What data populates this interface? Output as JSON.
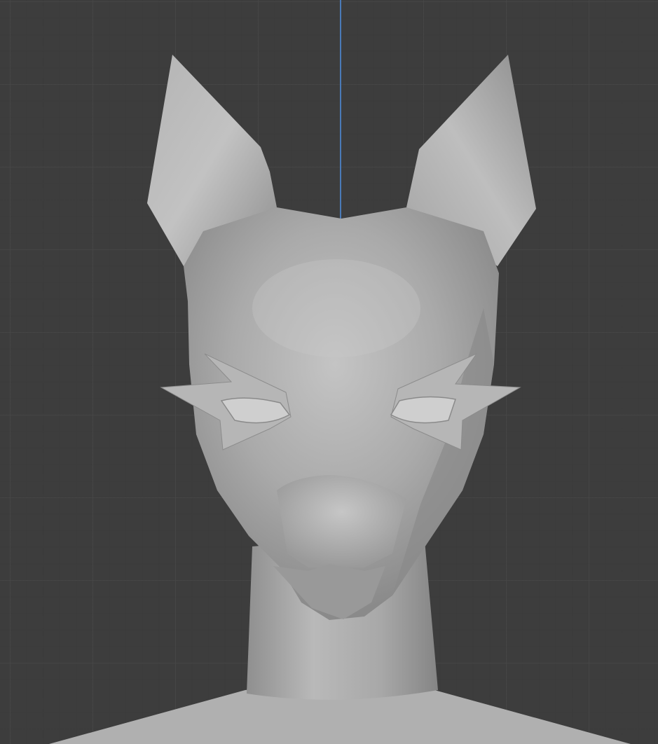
{
  "viewport": {
    "background_color": "#3d3d3d",
    "grid_color": "#464646",
    "axis_z_color": "#4a7ab8"
  },
  "model": {
    "base_color": "#a6a6a6",
    "highlight_color": "#c2c2c2",
    "shadow_color": "#7c7c7c",
    "icon": "3d-mesh-head"
  }
}
